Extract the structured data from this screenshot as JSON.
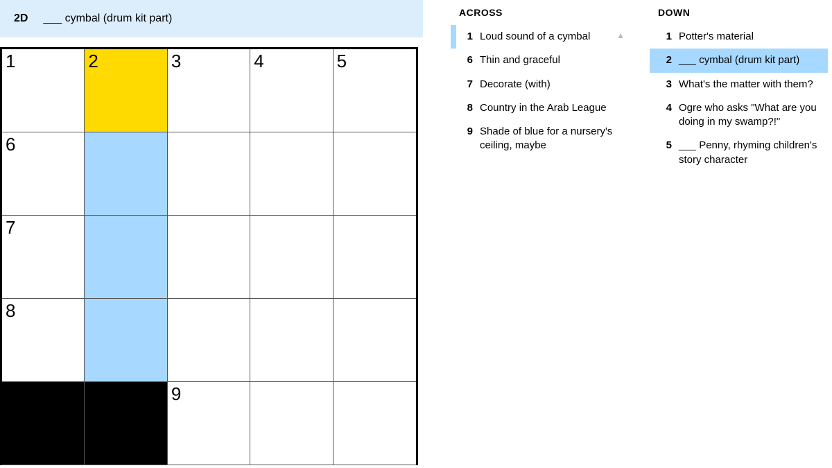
{
  "current_clue": {
    "label": "2D",
    "text": "___ cymbal (drum kit part)"
  },
  "grid": {
    "rows": 5,
    "cols": 5,
    "cells": [
      [
        {
          "n": "1"
        },
        {
          "n": "2",
          "state": "active"
        },
        {
          "n": "3"
        },
        {
          "n": "4"
        },
        {
          "n": "5"
        }
      ],
      [
        {
          "n": "6"
        },
        {
          "state": "highlight"
        },
        {},
        {},
        {}
      ],
      [
        {
          "n": "7"
        },
        {
          "state": "highlight"
        },
        {},
        {},
        {}
      ],
      [
        {
          "n": "8"
        },
        {
          "state": "highlight"
        },
        {},
        {},
        {}
      ],
      [
        {
          "state": "black"
        },
        {
          "state": "black"
        },
        {
          "n": "9"
        },
        {},
        {}
      ]
    ]
  },
  "across": {
    "heading": "ACROSS",
    "items": [
      {
        "n": "1",
        "text": "Loud sound of a cymbal",
        "related": true
      },
      {
        "n": "6",
        "text": "Thin and graceful"
      },
      {
        "n": "7",
        "text": "Decorate (with)"
      },
      {
        "n": "8",
        "text": "Country in the Arab League"
      },
      {
        "n": "9",
        "text": "Shade of blue for a nursery's ceiling, maybe"
      }
    ]
  },
  "down": {
    "heading": "DOWN",
    "items": [
      {
        "n": "1",
        "text": "Potter's material"
      },
      {
        "n": "2",
        "text": "___ cymbal (drum kit part)",
        "selected": true
      },
      {
        "n": "3",
        "text": "What's the matter with them?"
      },
      {
        "n": "4",
        "text": "Ogre who asks \"What are you doing in my swamp?!\""
      },
      {
        "n": "5",
        "text": "___ Penny, rhyming children's story character"
      }
    ]
  }
}
